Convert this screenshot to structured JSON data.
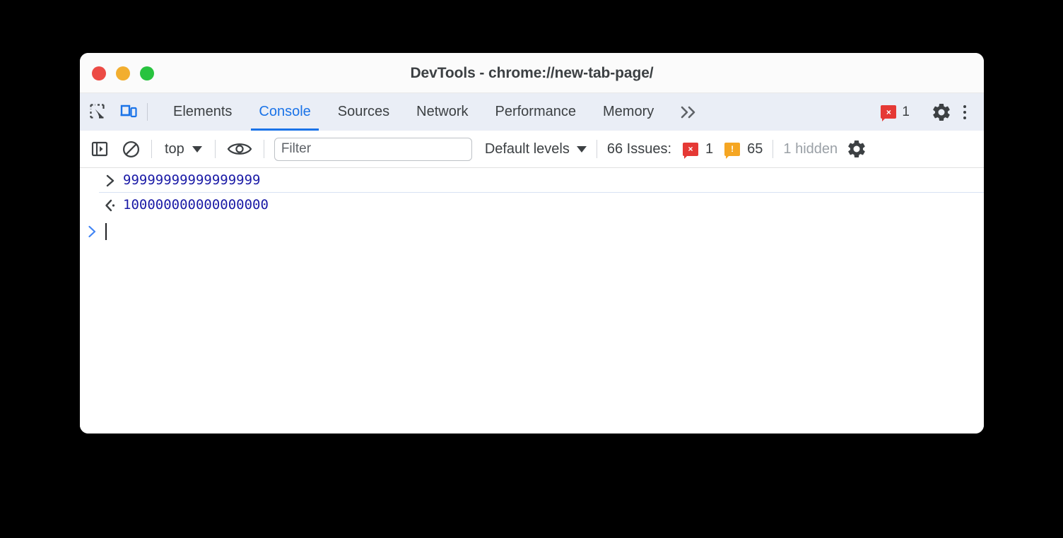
{
  "window": {
    "title": "DevTools - chrome://new-tab-page/",
    "traffic_lights": [
      {
        "name": "close",
        "color": "#ec4b45"
      },
      {
        "name": "minimize",
        "color": "#f2ae2f"
      },
      {
        "name": "maximize",
        "color": "#28c33f"
      }
    ]
  },
  "tabbar": {
    "left_icons": [
      {
        "name": "inspect-element-icon",
        "label": "Inspect element"
      },
      {
        "name": "device-toolbar-icon",
        "label": "Toggle device toolbar",
        "active": true
      }
    ],
    "tabs": [
      {
        "label": "Elements",
        "active": false
      },
      {
        "label": "Console",
        "active": true
      },
      {
        "label": "Sources",
        "active": false
      },
      {
        "label": "Network",
        "active": false
      },
      {
        "label": "Performance",
        "active": false
      },
      {
        "label": "Memory",
        "active": false
      }
    ],
    "overflow_label": "»",
    "error_badge": {
      "glyph": "×",
      "count": "1",
      "color": "#e53935"
    },
    "settings_icon": "gear-icon",
    "more_icon": "kebab-menu-icon"
  },
  "console_toolbar": {
    "sidebar_toggle": "show-console-sidebar-icon",
    "clear_console": "clear-console-icon",
    "context": {
      "value": "top",
      "caret": "▼"
    },
    "live_expression": "eye-icon",
    "filter": {
      "value": "",
      "placeholder": "Filter"
    },
    "levels": {
      "label": "Default levels",
      "caret": "▼"
    },
    "issues": {
      "label": "66 Issues:",
      "errors": {
        "glyph": "×",
        "count": "1",
        "color": "#e53935"
      },
      "warnings": {
        "glyph": "!",
        "count": "65",
        "color": "#f5a623"
      }
    },
    "hidden_label": "1 hidden",
    "settings_icon": "console-settings-gear-icon"
  },
  "console": {
    "rows": [
      {
        "kind": "input",
        "arrow": ">",
        "text": "99999999999999999"
      },
      {
        "kind": "output",
        "arrow": "<·",
        "text": "100000000000000000"
      }
    ],
    "prompt": {
      "arrow": ">",
      "value": ""
    }
  },
  "colors": {
    "accent": "#1a73e8",
    "tabbar_bg": "#eaeef6",
    "code_blue": "#1a1aa6",
    "error_red": "#e53935",
    "warning_orange": "#f5a623",
    "muted_text": "#9aa0a6"
  }
}
